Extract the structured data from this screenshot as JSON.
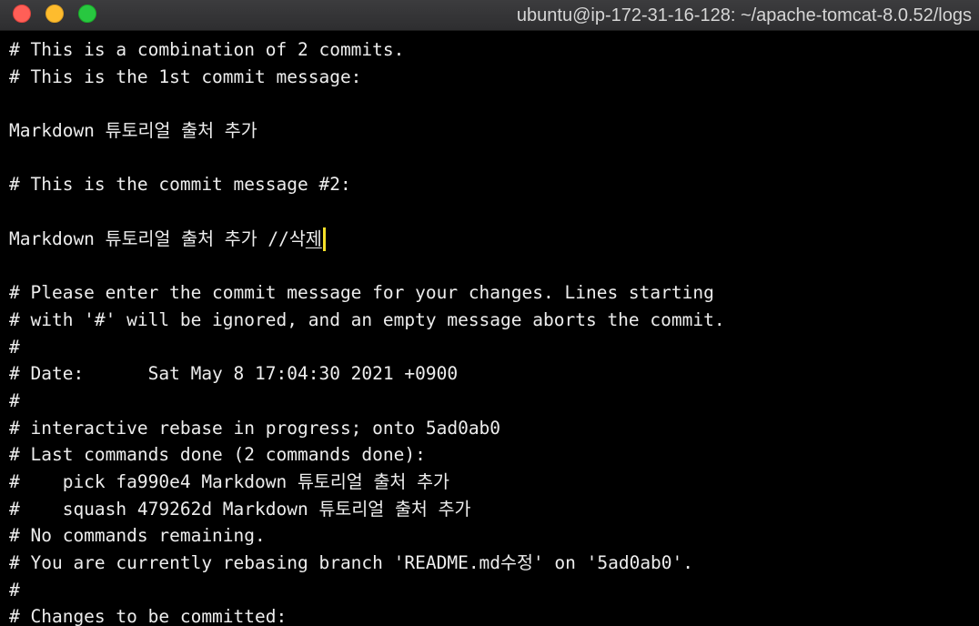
{
  "window": {
    "title": "ubuntu@ip-172-31-16-128: ~/apache-tomcat-8.0.52/logs"
  },
  "terminal": {
    "lines": [
      "# This is a combination of 2 commits.",
      "# This is the 1st commit message:",
      "",
      "Markdown 튜토리얼 출처 추가",
      "",
      "# This is the commit message #2:",
      "",
      "Markdown 튜토리얼 출처 추가 //삭",
      "",
      "# Please enter the commit message for your changes. Lines starting",
      "# with '#' will be ignored, and an empty message aborts the commit.",
      "#",
      "# Date:      Sat May 8 17:04:30 2021 +0900",
      "#",
      "# interactive rebase in progress; onto 5ad0ab0",
      "# Last commands done (2 commands done):",
      "#    pick fa990e4 Markdown 튜토리얼 출처 추가",
      "#    squash 479262d Markdown 튜토리얼 출처 추가",
      "# No commands remaining.",
      "# You are currently rebasing branch 'README.md수정' on '5ad0ab0'.",
      "#",
      "# Changes to be committed:"
    ],
    "editing_char": "제"
  },
  "colors": {
    "background": "#000000",
    "text": "#ededed",
    "cursor": "#f5e02a"
  }
}
